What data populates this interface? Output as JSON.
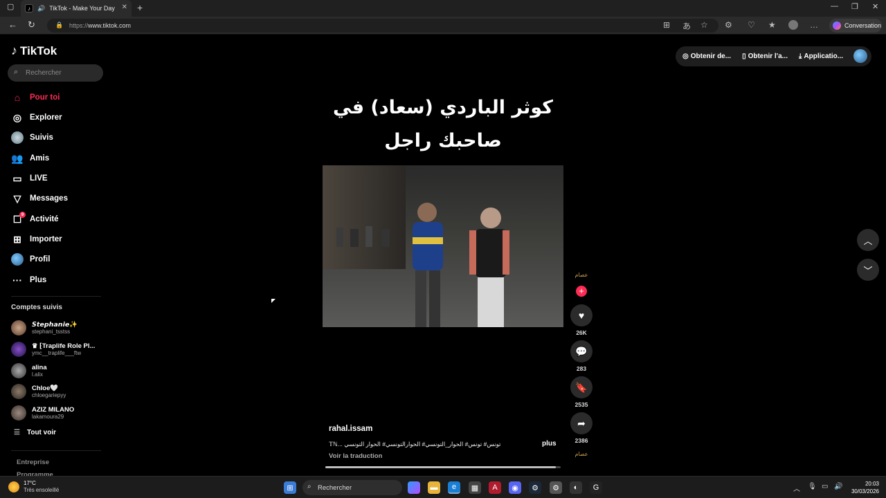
{
  "browser": {
    "tab_title": "TikTok - Make Your Day",
    "url_prefix": "https://",
    "url_host": "www.tiktok.com",
    "copilot_label": "Conversation"
  },
  "sidebar": {
    "logo": "TikTok",
    "search_placeholder": "Rechercher",
    "nav": [
      {
        "label": "Pour toi",
        "icon": "home-icon",
        "active": true
      },
      {
        "label": "Explorer",
        "icon": "compass-icon"
      },
      {
        "label": "Suivis",
        "icon": "following-avatar-icon"
      },
      {
        "label": "Amis",
        "icon": "friends-icon"
      },
      {
        "label": "LIVE",
        "icon": "live-icon"
      },
      {
        "label": "Messages",
        "icon": "messages-icon"
      },
      {
        "label": "Activité",
        "icon": "activity-icon",
        "badge": "9"
      },
      {
        "label": "Importer",
        "icon": "upload-icon"
      },
      {
        "label": "Profil",
        "icon": "profile-avatar-icon"
      },
      {
        "label": "Plus",
        "icon": "more-icon"
      }
    ],
    "following_title": "Comptes suivis",
    "accounts": [
      {
        "name": "𝙎𝙩𝙚𝙥𝙝𝙖𝙣𝙞𝙚✨",
        "handle": "stephani_tsstss"
      },
      {
        "name": "♛ ⁅Traplife Role Pl...",
        "handle": "ymc__traplife___ftw"
      },
      {
        "name": "alina",
        "handle": "l.alix"
      },
      {
        "name": "Chloe🤍",
        "handle": "chloegariepyy"
      },
      {
        "name": "AZIZ MILANO",
        "handle": "lakamoura29"
      }
    ],
    "see_all": "Tout voir",
    "footer": [
      "Entreprise",
      "Programme"
    ]
  },
  "topbar": {
    "buttons": [
      "Obtenir de...",
      "Obtenir l'a...",
      "Applicatio..."
    ]
  },
  "video": {
    "caption_line1": "كوثر الباردي (سعاد) في",
    "caption_line2": "صاحبك راجل",
    "author": "rahal.issam",
    "description": "تونس# تونس# الحوار_التونسي# الحوارالتونسي# الحوار التونسي ...𝕋ℕ",
    "more": "plus",
    "translate": "Voir la traduction",
    "progress": 0.98,
    "creator_badge": "عصام",
    "likes": "26K",
    "comments": "283",
    "saves": "2535",
    "shares": "2386"
  },
  "taskbar": {
    "temperature": "17°C",
    "weather": "Très ensoleillé",
    "search": "Rechercher",
    "time": "20:03",
    "date": "30/03/2026"
  }
}
